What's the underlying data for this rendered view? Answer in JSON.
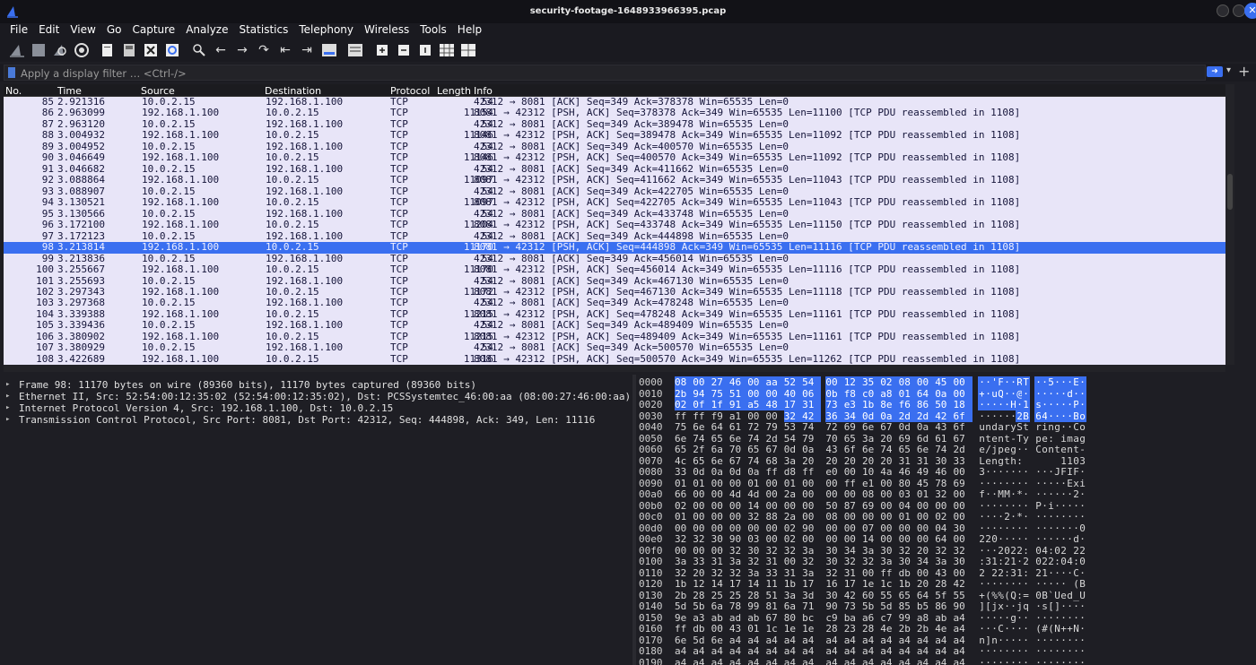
{
  "window": {
    "title": "security-footage-1648933966395.pcap",
    "close_glyph": "✕"
  },
  "menu": [
    "File",
    "Edit",
    "View",
    "Go",
    "Capture",
    "Analyze",
    "Statistics",
    "Telephony",
    "Wireless",
    "Tools",
    "Help"
  ],
  "toolbar": {
    "icons": [
      "shark-fin-start-icon",
      "stop-capture-icon",
      "restart-capture-icon",
      "capture-options-icon",
      "open-file-icon",
      "save-file-icon",
      "close-file-icon",
      "reload-file-icon",
      "find-packet-icon",
      "go-back-icon",
      "go-forward-icon",
      "go-to-packet-icon",
      "go-first-icon",
      "go-last-icon",
      "autoscroll-icon",
      "colorize-icon",
      "zoom-in-icon",
      "zoom-out-icon",
      "normal-size-icon",
      "resize-columns-icon",
      "layout-icon"
    ]
  },
  "filter": {
    "placeholder": "Apply a display filter … <Ctrl-/>"
  },
  "columns": {
    "no": "No.",
    "time": "Time",
    "source": "Source",
    "destination": "Destination",
    "protocol": "Protocol",
    "length": "Length",
    "info": "Info"
  },
  "packets": [
    {
      "no": "85",
      "time": "2.921316",
      "src": "10.0.2.15",
      "dst": "192.168.1.100",
      "proto": "TCP",
      "len": "54",
      "info": "42312 → 8081 [ACK] Seq=349 Ack=378378 Win=65535 Len=0"
    },
    {
      "no": "86",
      "time": "2.963099",
      "src": "192.168.1.100",
      "dst": "10.0.2.15",
      "proto": "TCP",
      "len": "11154",
      "info": "8081 → 42312 [PSH, ACK] Seq=378378 Ack=349 Win=65535 Len=11100 [TCP PDU reassembled in 1108]"
    },
    {
      "no": "87",
      "time": "2.963120",
      "src": "10.0.2.15",
      "dst": "192.168.1.100",
      "proto": "TCP",
      "len": "54",
      "info": "42312 → 8081 [ACK] Seq=349 Ack=389478 Win=65535 Len=0"
    },
    {
      "no": "88",
      "time": "3.004932",
      "src": "192.168.1.100",
      "dst": "10.0.2.15",
      "proto": "TCP",
      "len": "11146",
      "info": "8081 → 42312 [PSH, ACK] Seq=389478 Ack=349 Win=65535 Len=11092 [TCP PDU reassembled in 1108]"
    },
    {
      "no": "89",
      "time": "3.004952",
      "src": "10.0.2.15",
      "dst": "192.168.1.100",
      "proto": "TCP",
      "len": "54",
      "info": "42312 → 8081 [ACK] Seq=349 Ack=400570 Win=65535 Len=0"
    },
    {
      "no": "90",
      "time": "3.046649",
      "src": "192.168.1.100",
      "dst": "10.0.2.15",
      "proto": "TCP",
      "len": "11146",
      "info": "8081 → 42312 [PSH, ACK] Seq=400570 Ack=349 Win=65535 Len=11092 [TCP PDU reassembled in 1108]"
    },
    {
      "no": "91",
      "time": "3.046682",
      "src": "10.0.2.15",
      "dst": "192.168.1.100",
      "proto": "TCP",
      "len": "54",
      "info": "42312 → 8081 [ACK] Seq=349 Ack=411662 Win=65535 Len=0"
    },
    {
      "no": "92",
      "time": "3.088864",
      "src": "192.168.1.100",
      "dst": "10.0.2.15",
      "proto": "TCP",
      "len": "11097",
      "info": "8081 → 42312 [PSH, ACK] Seq=411662 Ack=349 Win=65535 Len=11043 [TCP PDU reassembled in 1108]"
    },
    {
      "no": "93",
      "time": "3.088907",
      "src": "10.0.2.15",
      "dst": "192.168.1.100",
      "proto": "TCP",
      "len": "54",
      "info": "42312 → 8081 [ACK] Seq=349 Ack=422705 Win=65535 Len=0"
    },
    {
      "no": "94",
      "time": "3.130521",
      "src": "192.168.1.100",
      "dst": "10.0.2.15",
      "proto": "TCP",
      "len": "11097",
      "info": "8081 → 42312 [PSH, ACK] Seq=422705 Ack=349 Win=65535 Len=11043 [TCP PDU reassembled in 1108]"
    },
    {
      "no": "95",
      "time": "3.130566",
      "src": "10.0.2.15",
      "dst": "192.168.1.100",
      "proto": "TCP",
      "len": "54",
      "info": "42312 → 8081 [ACK] Seq=349 Ack=433748 Win=65535 Len=0"
    },
    {
      "no": "96",
      "time": "3.172100",
      "src": "192.168.1.100",
      "dst": "10.0.2.15",
      "proto": "TCP",
      "len": "11204",
      "info": "8081 → 42312 [PSH, ACK] Seq=433748 Ack=349 Win=65535 Len=11150 [TCP PDU reassembled in 1108]"
    },
    {
      "no": "97",
      "time": "3.172123",
      "src": "10.0.2.15",
      "dst": "192.168.1.100",
      "proto": "TCP",
      "len": "54",
      "info": "42312 → 8081 [ACK] Seq=349 Ack=444898 Win=65535 Len=0"
    },
    {
      "no": "98",
      "time": "3.213814",
      "src": "192.168.1.100",
      "dst": "10.0.2.15",
      "proto": "TCP",
      "len": "11170",
      "info": "8081 → 42312 [PSH, ACK] Seq=444898 Ack=349 Win=65535 Len=11116 [TCP PDU reassembled in 1108]",
      "selected": true
    },
    {
      "no": "99",
      "time": "3.213836",
      "src": "10.0.2.15",
      "dst": "192.168.1.100",
      "proto": "TCP",
      "len": "54",
      "info": "42312 → 8081 [ACK] Seq=349 Ack=456014 Win=65535 Len=0"
    },
    {
      "no": "100",
      "time": "3.255667",
      "src": "192.168.1.100",
      "dst": "10.0.2.15",
      "proto": "TCP",
      "len": "11170",
      "info": "8081 → 42312 [PSH, ACK] Seq=456014 Ack=349 Win=65535 Len=11116 [TCP PDU reassembled in 1108]"
    },
    {
      "no": "101",
      "time": "3.255693",
      "src": "10.0.2.15",
      "dst": "192.168.1.100",
      "proto": "TCP",
      "len": "54",
      "info": "42312 → 8081 [ACK] Seq=349 Ack=467130 Win=65535 Len=0"
    },
    {
      "no": "102",
      "time": "3.297343",
      "src": "192.168.1.100",
      "dst": "10.0.2.15",
      "proto": "TCP",
      "len": "11172",
      "info": "8081 → 42312 [PSH, ACK] Seq=467130 Ack=349 Win=65535 Len=11118 [TCP PDU reassembled in 1108]"
    },
    {
      "no": "103",
      "time": "3.297368",
      "src": "10.0.2.15",
      "dst": "192.168.1.100",
      "proto": "TCP",
      "len": "54",
      "info": "42312 → 8081 [ACK] Seq=349 Ack=478248 Win=65535 Len=0"
    },
    {
      "no": "104",
      "time": "3.339388",
      "src": "192.168.1.100",
      "dst": "10.0.2.15",
      "proto": "TCP",
      "len": "11215",
      "info": "8081 → 42312 [PSH, ACK] Seq=478248 Ack=349 Win=65535 Len=11161 [TCP PDU reassembled in 1108]"
    },
    {
      "no": "105",
      "time": "3.339436",
      "src": "10.0.2.15",
      "dst": "192.168.1.100",
      "proto": "TCP",
      "len": "54",
      "info": "42312 → 8081 [ACK] Seq=349 Ack=489409 Win=65535 Len=0"
    },
    {
      "no": "106",
      "time": "3.380902",
      "src": "192.168.1.100",
      "dst": "10.0.2.15",
      "proto": "TCP",
      "len": "11215",
      "info": "8081 → 42312 [PSH, ACK] Seq=489409 Ack=349 Win=65535 Len=11161 [TCP PDU reassembled in 1108]"
    },
    {
      "no": "107",
      "time": "3.380929",
      "src": "10.0.2.15",
      "dst": "192.168.1.100",
      "proto": "TCP",
      "len": "54",
      "info": "42312 → 8081 [ACK] Seq=349 Ack=500570 Win=65535 Len=0"
    },
    {
      "no": "108",
      "time": "3.422689",
      "src": "192.168.1.100",
      "dst": "10.0.2.15",
      "proto": "TCP",
      "len": "11316",
      "info": "8081 → 42312 [PSH, ACK] Seq=500570 Ack=349 Win=65535 Len=11262 [TCP PDU reassembled in 1108]"
    }
  ],
  "details": [
    "Frame 98: 11170 bytes on wire (89360 bits), 11170 bytes captured (89360 bits)",
    "Ethernet II, Src: 52:54:00:12:35:02 (52:54:00:12:35:02), Dst: PCSSystemtec_46:00:aa (08:00:27:46:00:aa)",
    "Internet Protocol Version 4, Src: 192.168.1.100, Dst: 10.0.2.15",
    "Transmission Control Protocol, Src Port: 8081, Dst Port: 42312, Seq: 444898, Ack: 349, Len: 11116"
  ],
  "hex": [
    {
      "off": "0000",
      "bytes": "08 00 27 46 00 aa 52 54 00 12 35 02 08 00 45 00",
      "ascii": "··'F··RT ··5···E·",
      "hl": 0
    },
    {
      "off": "0010",
      "bytes": "2b 94 75 51 00 00 40 06 0b f8 c0 a8 01 64 0a 00",
      "ascii": "+·uQ··@· ·····d··",
      "hl": 0
    },
    {
      "off": "0020",
      "bytes": "02 0f 1f 91 a5 48 17 31 73 e3 1b 8e f6 86 50 18",
      "ascii": "·····H·1 s·····P·",
      "hl": 0
    },
    {
      "off": "0030",
      "bytes": "ff ff f9 a1 00 00 32 42 36 34 0d 0a 2d 2d 42 6f",
      "ascii": "······2B 64····Bo",
      "hl": 6
    },
    {
      "off": "0040",
      "bytes": "75 6e 64 61 72 79 53 74 72 69 6e 67 0d 0a 43 6f",
      "ascii": "undarySt ring··Co",
      "hl": 16
    },
    {
      "off": "0050",
      "bytes": "6e 74 65 6e 74 2d 54 79 70 65 3a 20 69 6d 61 67",
      "ascii": "ntent-Ty pe: imag",
      "hl": 16
    },
    {
      "off": "0060",
      "bytes": "65 2f 6a 70 65 67 0d 0a 43 6f 6e 74 65 6e 74 2d",
      "ascii": "e/jpeg·· Content-",
      "hl": 16
    },
    {
      "off": "0070",
      "bytes": "4c 65 6e 67 74 68 3a 20 20 20 20 20 31 31 30 33",
      "ascii": "Length:      1103",
      "hl": 16
    },
    {
      "off": "0080",
      "bytes": "33 0d 0a 0d 0a ff d8 ff e0 00 10 4a 46 49 46 00",
      "ascii": "3······· ···JFIF·",
      "hl": 16
    },
    {
      "off": "0090",
      "bytes": "01 01 00 00 01 00 01 00 00 ff e1 00 80 45 78 69",
      "ascii": "········ ·····Exi",
      "hl": 16
    },
    {
      "off": "00a0",
      "bytes": "66 00 00 4d 4d 00 2a 00 00 00 08 00 03 01 32 00",
      "ascii": "f··MM·*· ······2·",
      "hl": 16
    },
    {
      "off": "00b0",
      "bytes": "02 00 00 00 14 00 00 00 50 87 69 00 04 00 00 00",
      "ascii": "········ P·i·····",
      "hl": 16
    },
    {
      "off": "00c0",
      "bytes": "01 00 00 00 32 88 2a 00 08 00 00 00 01 00 02 00",
      "ascii": "····2·*· ········",
      "hl": 16
    },
    {
      "off": "00d0",
      "bytes": "00 00 00 00 00 00 02 90 00 00 07 00 00 00 04 30",
      "ascii": "········ ·······0",
      "hl": 16
    },
    {
      "off": "00e0",
      "bytes": "32 32 30 90 03 00 02 00 00 00 14 00 00 00 64 00",
      "ascii": "220····· ······d·",
      "hl": 16
    },
    {
      "off": "00f0",
      "bytes": "00 00 00 32 30 32 32 3a 30 34 3a 30 32 20 32 32",
      "ascii": "···2022: 04:02 22",
      "hl": 16
    },
    {
      "off": "0100",
      "bytes": "3a 33 31 3a 32 31 00 32 30 32 32 3a 30 34 3a 30",
      "ascii": ":31:21·2 022:04:0",
      "hl": 16
    },
    {
      "off": "0110",
      "bytes": "32 20 32 32 3a 33 31 3a 32 31 00 ff db 00 43 00",
      "ascii": "2 22:31: 21····C·",
      "hl": 16
    },
    {
      "off": "0120",
      "bytes": "1b 12 14 17 14 11 1b 17 16 17 1e 1c 1b 20 28 42",
      "ascii": "········ ····· (B",
      "hl": 16
    },
    {
      "off": "0130",
      "bytes": "2b 28 25 25 28 51 3a 3d 30 42 60 55 65 64 5f 55",
      "ascii": "+(%%(Q:= 0B`Ued_U",
      "hl": 16
    },
    {
      "off": "0140",
      "bytes": "5d 5b 6a 78 99 81 6a 71 90 73 5b 5d 85 b5 86 90",
      "ascii": "][jx··jq ·s[]····",
      "hl": 16
    },
    {
      "off": "0150",
      "bytes": "9e a3 ab ad ab 67 80 bc c9 ba a6 c7 99 a8 ab a4",
      "ascii": "·····g·· ········",
      "hl": 16
    },
    {
      "off": "0160",
      "bytes": "ff db 00 43 01 1c 1e 1e 28 23 28 4e 2b 2b 4e a4",
      "ascii": "···C···· (#(N++N·",
      "hl": 16
    },
    {
      "off": "0170",
      "bytes": "6e 5d 6e a4 a4 a4 a4 a4 a4 a4 a4 a4 a4 a4 a4 a4",
      "ascii": "n]n····· ········",
      "hl": 16
    },
    {
      "off": "0180",
      "bytes": "a4 a4 a4 a4 a4 a4 a4 a4 a4 a4 a4 a4 a4 a4 a4 a4",
      "ascii": "········ ········",
      "hl": 16
    },
    {
      "off": "0190",
      "bytes": "a4 a4 a4 a4 a4 a4 a4 a4 a4 a4 a4 a4 a4 a4 a4 a4",
      "ascii": "········ ········",
      "hl": 16
    }
  ]
}
